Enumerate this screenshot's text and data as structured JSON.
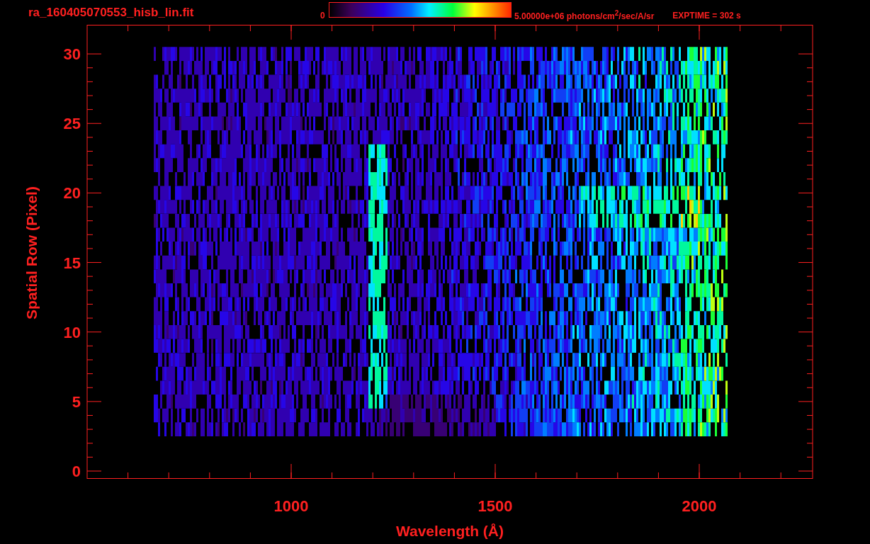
{
  "title": "ra_160405070553_hisb_lin.fit",
  "colorbar": {
    "min_label": "0",
    "max_label": "5.00000e+06 photons/cm$^{2}$/sec/A/sr"
  },
  "exptime": "EXPTIME = 302 s",
  "x_axis": {
    "label": "Wavelength (Å)",
    "ticks": [
      "1000",
      "1500",
      "2000"
    ]
  },
  "y_axis": {
    "label": "Spatial Row (Pixel)",
    "ticks": [
      "30",
      "25",
      "20",
      "15",
      "10",
      "5",
      "0"
    ]
  }
}
